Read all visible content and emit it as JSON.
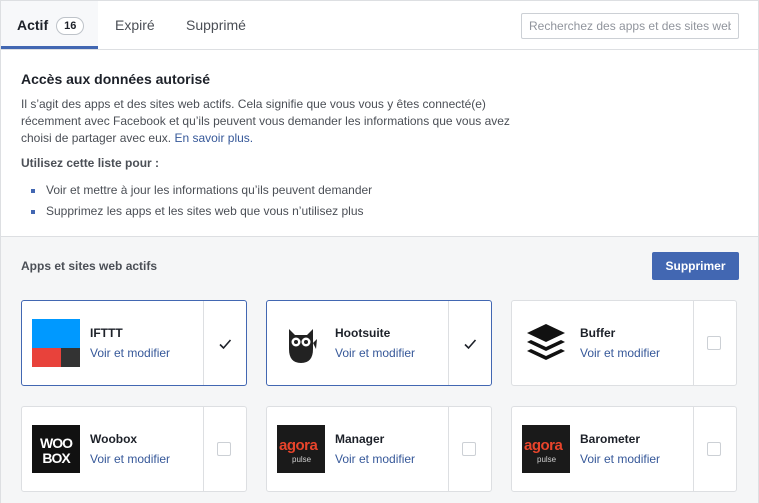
{
  "tabs": {
    "actif": "Actif",
    "actif_count": "16",
    "expire": "Expiré",
    "supprime": "Supprimé"
  },
  "search": {
    "placeholder": "Recherchez des apps et des sites web"
  },
  "info": {
    "title": "Accès aux données autorisé",
    "line1": "Il s’agit des apps et des sites web actifs. Cela signifie que vous vous y êtes connecté(e)",
    "line2": "récemment avec Facebook et qu’ils peuvent vous demander les informations que vous avez",
    "line3": "choisi de partager avec eux.",
    "learn_more": "En savoir plus.",
    "use_title": "Utilisez cette liste pour :",
    "bullets": [
      "Voir et mettre à jour les informations qu’ils peuvent demander",
      "Supprimez les apps et les sites web que vous n’utilisez plus"
    ]
  },
  "active": {
    "title": "Apps et sites web actifs",
    "delete_button": "Supprimer",
    "apps": [
      {
        "name": "IFTTT",
        "link": "Voir et modifier",
        "checked": true,
        "icon": "ifttt-logo"
      },
      {
        "name": "Hootsuite",
        "link": "Voir et modifier",
        "checked": true,
        "icon": "hootsuite-owl-logo"
      },
      {
        "name": "Buffer",
        "link": "Voir et modifier",
        "checked": false,
        "icon": "buffer-stack-logo"
      },
      {
        "name": "Woobox",
        "link": "Voir et modifier",
        "checked": false,
        "icon": "woobox-logo",
        "logo_line1": "WOO",
        "logo_line2": "BOX"
      },
      {
        "name": "Manager",
        "link": "Voir et modifier",
        "checked": false,
        "icon": "agorapulse-logo",
        "logo_line1": "agora",
        "logo_line2": "pulse"
      },
      {
        "name": "Barometer",
        "link": "Voir et modifier",
        "checked": false,
        "icon": "agorapulse-logo",
        "logo_line1": "agora",
        "logo_line2": "pulse"
      }
    ]
  },
  "colors": {
    "accent": "#4267b2",
    "link": "#365899",
    "ifttt_blue": "#0099ff",
    "ifttt_red": "#e8423b"
  }
}
